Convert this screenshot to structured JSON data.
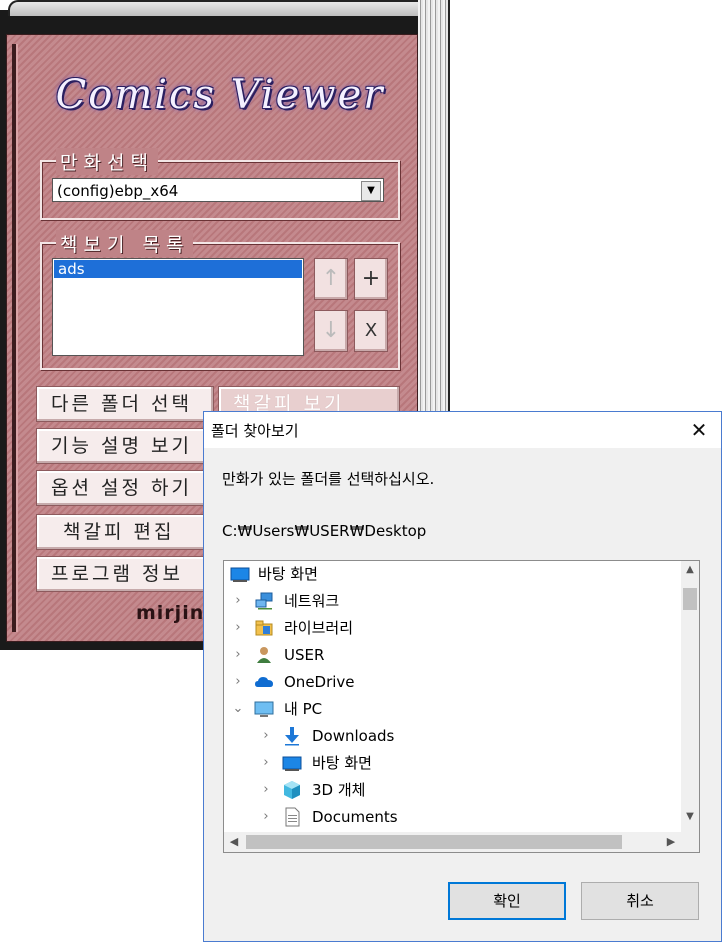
{
  "viewer": {
    "title": "Comics Viewer",
    "comic_select_label": "만화선택",
    "comic_select_value": "(config)ebp_x64",
    "book_list_label": "책보기 목록",
    "book_list_items": [
      "ads"
    ],
    "buttons": {
      "up": "↑",
      "add": "+",
      "down": "↓",
      "delete": "X",
      "other_folder": "다른 폴더 선택",
      "bookmark_view": "책갈피 보기",
      "feature_help": "기능 설명 보기",
      "options": "옵션 설정 하기",
      "bookmark_edit": "책갈피 편집",
      "program_info": "프로그램 정보"
    },
    "author": "mirjin"
  },
  "dialog": {
    "title": "폴더 찾아보기",
    "message": "만화가 있는 폴더를 선택하십시오.",
    "path": "C:₩Users₩USER₩Desktop",
    "tree": [
      {
        "label": "바탕 화면",
        "icon": "desktop-icon",
        "level": 0,
        "expandable": false,
        "expanded": false
      },
      {
        "label": "네트워크",
        "icon": "network-icon",
        "level": 1,
        "expandable": true,
        "expanded": false
      },
      {
        "label": "라이브러리",
        "icon": "library-icon",
        "level": 1,
        "expandable": true,
        "expanded": false
      },
      {
        "label": "USER",
        "icon": "user-icon",
        "level": 1,
        "expandable": true,
        "expanded": false
      },
      {
        "label": "OneDrive",
        "icon": "onedrive-cloud-icon",
        "level": 1,
        "expandable": true,
        "expanded": false
      },
      {
        "label": "내 PC",
        "icon": "pc-icon",
        "level": 1,
        "expandable": true,
        "expanded": true
      },
      {
        "label": "Downloads",
        "icon": "download-arrow-icon",
        "level": 2,
        "expandable": true,
        "expanded": false
      },
      {
        "label": "바탕 화면",
        "icon": "desktop-icon",
        "level": 2,
        "expandable": true,
        "expanded": false
      },
      {
        "label": "3D 개체",
        "icon": "3d-objects-icon",
        "level": 2,
        "expandable": true,
        "expanded": false
      },
      {
        "label": "Documents",
        "icon": "document-icon",
        "level": 2,
        "expandable": true,
        "expanded": false
      }
    ],
    "ok_label": "확인",
    "cancel_label": "취소",
    "close_glyph": "✕"
  }
}
